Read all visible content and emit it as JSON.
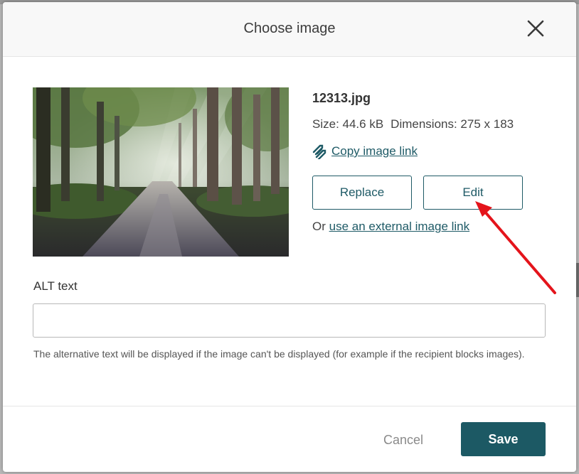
{
  "dialog": {
    "title": "Choose image",
    "close_icon": "close-icon"
  },
  "image": {
    "alt_description_icon": "forest-photo",
    "file_name": "12313.jpg",
    "size_text": "Size: 44.6 kB",
    "dimensions_text": "Dimensions: 275 x 183",
    "copy_link_icon": "link-icon",
    "copy_link_label": "Copy image link"
  },
  "actions": {
    "replace_label": "Replace",
    "edit_label": "Edit",
    "external_prefix": "Or",
    "external_link_label": "use an external image link"
  },
  "alt": {
    "label": "ALT text",
    "value": "",
    "placeholder": "",
    "help": "The alternative text will be displayed if the image can't be displayed (for example if the recipient blocks images)."
  },
  "footer": {
    "cancel_label": "Cancel",
    "save_label": "Save"
  },
  "colors": {
    "accent": "#1c5964",
    "link": "#1e5a66",
    "annotation_arrow": "#e4141b"
  }
}
